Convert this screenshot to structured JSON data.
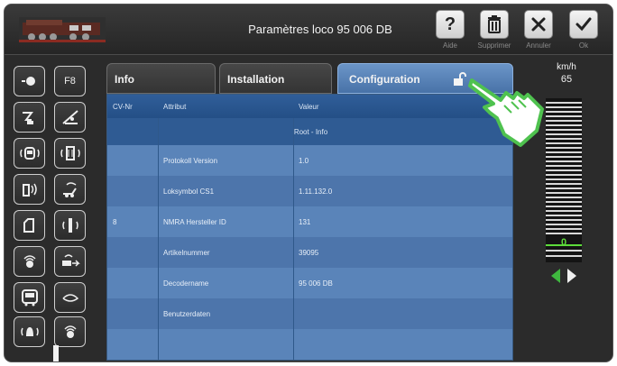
{
  "header": {
    "title": "Paramètres loco 95 006 DB"
  },
  "toolbar": {
    "help_label": "Aide",
    "delete_label": "Supprimer",
    "cancel_label": "Annuler",
    "ok_label": "Ok"
  },
  "tabs": [
    {
      "label": "Info"
    },
    {
      "label": "Installation"
    },
    {
      "label": "Configuration",
      "active": true
    }
  ],
  "table": {
    "headers": {
      "cv": "CV-Nr",
      "attr": "Attribut",
      "value": "Valeur"
    },
    "section": "Root - Info",
    "rows": [
      {
        "cv": "",
        "attr": "Protokoll Version",
        "value": "1.0"
      },
      {
        "cv": "",
        "attr": "Loksymbol CS1",
        "value": "1.11.132.0"
      },
      {
        "cv": "8",
        "attr": "NMRA Hersteller ID",
        "value": "131"
      },
      {
        "cv": "",
        "attr": "Artikelnummer",
        "value": "39095"
      },
      {
        "cv": "",
        "attr": "Decodername",
        "value": "95 006 DB"
      },
      {
        "cv": "",
        "attr": "Benutzerdaten",
        "value": ""
      }
    ]
  },
  "speed": {
    "unit": "km/h",
    "value": "65",
    "level_marker": "0"
  },
  "function_keys": [
    "headlight-icon",
    "f8-label-icon",
    "pantograph-icon",
    "shunting-icon",
    "cab-light-icon",
    "interior-light-icon",
    "horn-icon",
    "coupling-icon",
    "door-icon",
    "whistle-icon",
    "sound-icon",
    "brake-sound-icon",
    "compressor-icon",
    "steam-icon",
    "bell-icon",
    "loudspeaker-icon"
  ],
  "function_key_text": {
    "f8": "F8"
  },
  "colors": {
    "table_blue": "#4f77ab",
    "active_tab": "#5b86bd",
    "speed_marker": "#5ddc3a",
    "pointer_green": "#4fc24f"
  }
}
